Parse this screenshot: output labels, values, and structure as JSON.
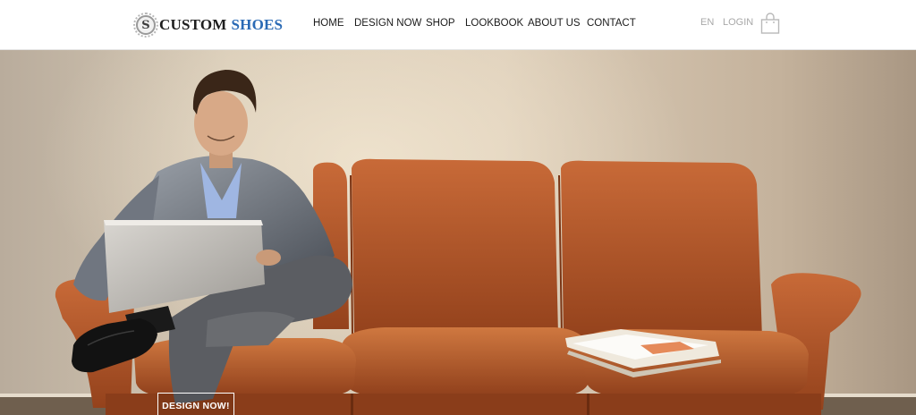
{
  "brand": {
    "word1": "CUSTOM",
    "word2": "SHOES",
    "badge_letter": "S",
    "accent_color": "#2a6ab5"
  },
  "nav": [
    {
      "label": "HOME"
    },
    {
      "label": "DESIGN NOW"
    },
    {
      "label": "SHOP"
    },
    {
      "label": "LOOKBOOK"
    },
    {
      "label": "ABOUT US"
    },
    {
      "label": "CONTACT"
    }
  ],
  "utility": {
    "language": "EN",
    "login": "LOGIN",
    "cart_icon": "shopping-bag-icon"
  },
  "hero": {
    "cta_label": "DESIGN NOW!",
    "image_subject": "man with laptop on orange leather sofa",
    "sofa_color": "#b2562a"
  }
}
